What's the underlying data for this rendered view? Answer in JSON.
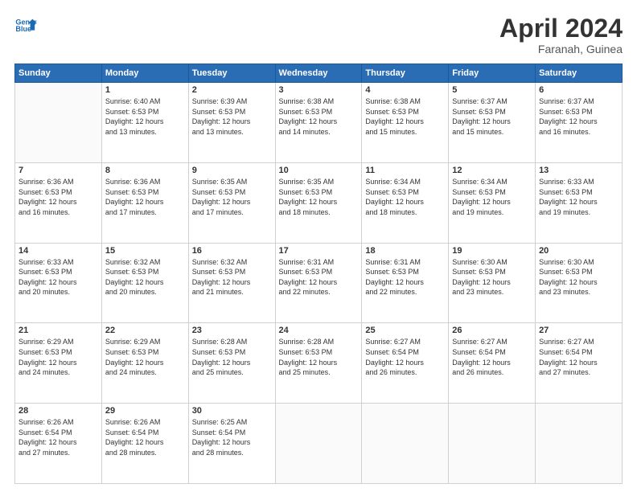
{
  "header": {
    "logo_line1": "General",
    "logo_line2": "Blue",
    "title": "April 2024",
    "location": "Faranah, Guinea"
  },
  "days_of_week": [
    "Sunday",
    "Monday",
    "Tuesday",
    "Wednesday",
    "Thursday",
    "Friday",
    "Saturday"
  ],
  "weeks": [
    [
      {
        "day": "",
        "info": ""
      },
      {
        "day": "1",
        "info": "Sunrise: 6:40 AM\nSunset: 6:53 PM\nDaylight: 12 hours\nand 13 minutes."
      },
      {
        "day": "2",
        "info": "Sunrise: 6:39 AM\nSunset: 6:53 PM\nDaylight: 12 hours\nand 13 minutes."
      },
      {
        "day": "3",
        "info": "Sunrise: 6:38 AM\nSunset: 6:53 PM\nDaylight: 12 hours\nand 14 minutes."
      },
      {
        "day": "4",
        "info": "Sunrise: 6:38 AM\nSunset: 6:53 PM\nDaylight: 12 hours\nand 15 minutes."
      },
      {
        "day": "5",
        "info": "Sunrise: 6:37 AM\nSunset: 6:53 PM\nDaylight: 12 hours\nand 15 minutes."
      },
      {
        "day": "6",
        "info": "Sunrise: 6:37 AM\nSunset: 6:53 PM\nDaylight: 12 hours\nand 16 minutes."
      }
    ],
    [
      {
        "day": "7",
        "info": "Sunrise: 6:36 AM\nSunset: 6:53 PM\nDaylight: 12 hours\nand 16 minutes."
      },
      {
        "day": "8",
        "info": "Sunrise: 6:36 AM\nSunset: 6:53 PM\nDaylight: 12 hours\nand 17 minutes."
      },
      {
        "day": "9",
        "info": "Sunrise: 6:35 AM\nSunset: 6:53 PM\nDaylight: 12 hours\nand 17 minutes."
      },
      {
        "day": "10",
        "info": "Sunrise: 6:35 AM\nSunset: 6:53 PM\nDaylight: 12 hours\nand 18 minutes."
      },
      {
        "day": "11",
        "info": "Sunrise: 6:34 AM\nSunset: 6:53 PM\nDaylight: 12 hours\nand 18 minutes."
      },
      {
        "day": "12",
        "info": "Sunrise: 6:34 AM\nSunset: 6:53 PM\nDaylight: 12 hours\nand 19 minutes."
      },
      {
        "day": "13",
        "info": "Sunrise: 6:33 AM\nSunset: 6:53 PM\nDaylight: 12 hours\nand 19 minutes."
      }
    ],
    [
      {
        "day": "14",
        "info": "Sunrise: 6:33 AM\nSunset: 6:53 PM\nDaylight: 12 hours\nand 20 minutes."
      },
      {
        "day": "15",
        "info": "Sunrise: 6:32 AM\nSunset: 6:53 PM\nDaylight: 12 hours\nand 20 minutes."
      },
      {
        "day": "16",
        "info": "Sunrise: 6:32 AM\nSunset: 6:53 PM\nDaylight: 12 hours\nand 21 minutes."
      },
      {
        "day": "17",
        "info": "Sunrise: 6:31 AM\nSunset: 6:53 PM\nDaylight: 12 hours\nand 22 minutes."
      },
      {
        "day": "18",
        "info": "Sunrise: 6:31 AM\nSunset: 6:53 PM\nDaylight: 12 hours\nand 22 minutes."
      },
      {
        "day": "19",
        "info": "Sunrise: 6:30 AM\nSunset: 6:53 PM\nDaylight: 12 hours\nand 23 minutes."
      },
      {
        "day": "20",
        "info": "Sunrise: 6:30 AM\nSunset: 6:53 PM\nDaylight: 12 hours\nand 23 minutes."
      }
    ],
    [
      {
        "day": "21",
        "info": "Sunrise: 6:29 AM\nSunset: 6:53 PM\nDaylight: 12 hours\nand 24 minutes."
      },
      {
        "day": "22",
        "info": "Sunrise: 6:29 AM\nSunset: 6:53 PM\nDaylight: 12 hours\nand 24 minutes."
      },
      {
        "day": "23",
        "info": "Sunrise: 6:28 AM\nSunset: 6:53 PM\nDaylight: 12 hours\nand 25 minutes."
      },
      {
        "day": "24",
        "info": "Sunrise: 6:28 AM\nSunset: 6:53 PM\nDaylight: 12 hours\nand 25 minutes."
      },
      {
        "day": "25",
        "info": "Sunrise: 6:27 AM\nSunset: 6:54 PM\nDaylight: 12 hours\nand 26 minutes."
      },
      {
        "day": "26",
        "info": "Sunrise: 6:27 AM\nSunset: 6:54 PM\nDaylight: 12 hours\nand 26 minutes."
      },
      {
        "day": "27",
        "info": "Sunrise: 6:27 AM\nSunset: 6:54 PM\nDaylight: 12 hours\nand 27 minutes."
      }
    ],
    [
      {
        "day": "28",
        "info": "Sunrise: 6:26 AM\nSunset: 6:54 PM\nDaylight: 12 hours\nand 27 minutes."
      },
      {
        "day": "29",
        "info": "Sunrise: 6:26 AM\nSunset: 6:54 PM\nDaylight: 12 hours\nand 28 minutes."
      },
      {
        "day": "30",
        "info": "Sunrise: 6:25 AM\nSunset: 6:54 PM\nDaylight: 12 hours\nand 28 minutes."
      },
      {
        "day": "",
        "info": ""
      },
      {
        "day": "",
        "info": ""
      },
      {
        "day": "",
        "info": ""
      },
      {
        "day": "",
        "info": ""
      }
    ]
  ]
}
